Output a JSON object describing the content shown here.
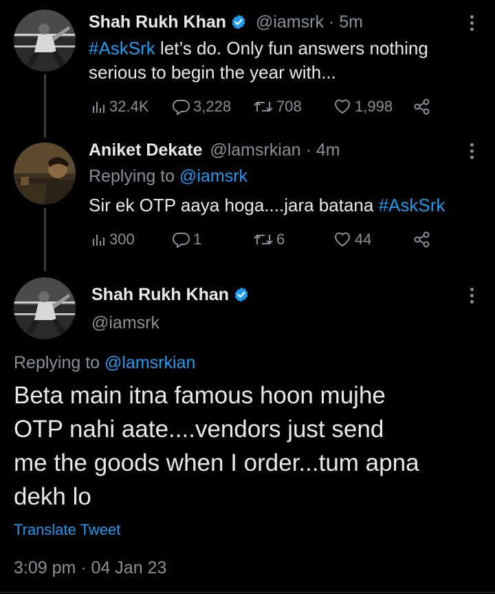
{
  "tweet1": {
    "author_name": "Shah Rukh Khan",
    "handle": "@iamsrk",
    "time": "· 5m",
    "hashtag": "#AskSrk",
    "text_line1_rest": " let’s do. Only fun answers nothing",
    "text_line2": "serious to begin the year with...",
    "views": "32.4K",
    "replies": "3,228",
    "retweets": "708",
    "likes": "1,998"
  },
  "tweet2": {
    "author_name": "Aniket Dekate",
    "handle": "@lamsrkian",
    "time": "· 4m",
    "replying_prefix": "Replying to ",
    "replying_handle": "@iamsrk",
    "text": "Sir ek OTP aaya hoga....jara batana ",
    "hashtag": "#AskSrk",
    "views": "300",
    "replies": "1",
    "retweets": "6",
    "likes": "44"
  },
  "main_tweet": {
    "author_name": "Shah Rukh Khan",
    "handle": "@iamsrk",
    "replying_prefix": "Replying to ",
    "replying_handle": "@lamsrkian",
    "text_lines": [
      "Beta main itna famous hoon mujhe",
      "OTP nahi aate....vendors just send",
      "me the goods when I order...tum apna",
      "dekh lo"
    ],
    "translate_label": "Translate Tweet",
    "timestamp": "3:09 pm · 04 Jan 23"
  },
  "colors": {
    "background": "#000000",
    "text": "#e7e9ea",
    "secondary": "#8b9196",
    "accent": "#1d9bf0",
    "verified": "#1d9bf0"
  },
  "icons": [
    "views-icon",
    "reply-icon",
    "retweet-icon",
    "like-icon",
    "share-icon",
    "more-icon",
    "verified-badge-icon"
  ]
}
